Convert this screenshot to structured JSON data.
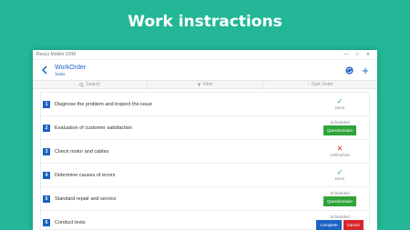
{
  "headline": "Work instractions",
  "window": {
    "app_title": "Resco Mobile CRM",
    "controls": [
      "—",
      "□",
      "✕"
    ]
  },
  "header": {
    "title": "WorkOrder",
    "subtitle": "Tasks"
  },
  "toolbar": {
    "search": "Search",
    "filter": "Filter",
    "order": "Task Order"
  },
  "tasks": [
    {
      "num": "1",
      "label": "Diagnose the problem and inspect the issue",
      "status": "Done"
    },
    {
      "num": "2",
      "label": "Evaluation of customer satisfaction",
      "status": "Scheduled",
      "action": "Questionnaire"
    },
    {
      "num": "3",
      "label": "Check motor and cables",
      "status": "Unfinished"
    },
    {
      "num": "4",
      "label": "Determine causes of errors",
      "status": "Done"
    },
    {
      "num": "5",
      "label": "Standard repair and service",
      "status": "Scheduled",
      "action": "Questionnaire"
    },
    {
      "num": "6",
      "label": "Conduct tests",
      "status": "Scheduled",
      "action": "Complete",
      "action2": "Cancel"
    }
  ],
  "colors": {
    "background": "#23b797",
    "accent": "#1a62c4",
    "done": "#2fa84f",
    "unfinished": "#d6262c"
  }
}
